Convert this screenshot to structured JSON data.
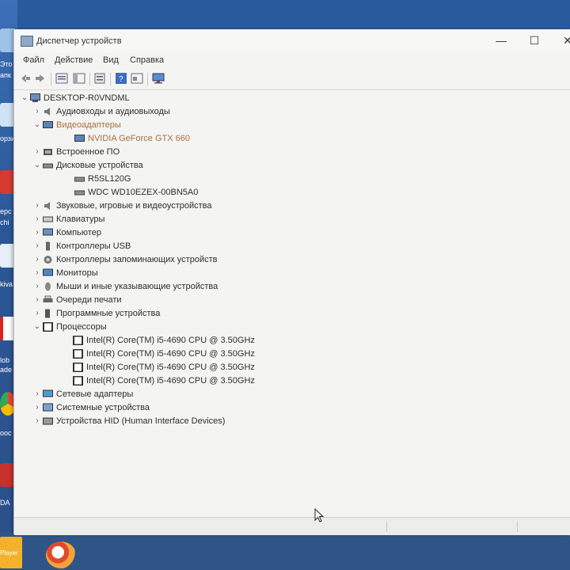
{
  "desktop": {
    "left_labels": [
      "Это",
      "апк",
      "орзи",
      "ерс",
      "chi",
      "kiva",
      "lob",
      "ade",
      "ooc",
      "DA"
    ],
    "player_label": "Player"
  },
  "window": {
    "title": "Диспетчер устройств",
    "controls": {
      "minimize": "—",
      "maximize": "☐",
      "close": "✕"
    }
  },
  "menu": [
    "Файл",
    "Действие",
    "Вид",
    "Справка"
  ],
  "tree": {
    "root": "DESKTOP-R0VNDML",
    "nodes": [
      {
        "label": "Аудиовходы и аудиовыходы",
        "expanded": false,
        "icon": "audio-icon"
      },
      {
        "label": "Видеоадаптеры",
        "expanded": true,
        "icon": "display-adapter-icon",
        "children": [
          "NVIDIA GeForce GTX 660"
        ]
      },
      {
        "label": "Встроенное ПО",
        "expanded": false,
        "icon": "firmware-icon"
      },
      {
        "label": "Дисковые устройства",
        "expanded": true,
        "icon": "disk-icon",
        "children": [
          "R5SL120G",
          "WDC WD10EZEX-00BN5A0"
        ]
      },
      {
        "label": "Звуковые, игровые и видеоустройства",
        "expanded": false,
        "icon": "sound-icon"
      },
      {
        "label": "Клавиатуры",
        "expanded": false,
        "icon": "keyboard-icon"
      },
      {
        "label": "Компьютер",
        "expanded": false,
        "icon": "computer-icon"
      },
      {
        "label": "Контроллеры USB",
        "expanded": false,
        "icon": "usb-icon"
      },
      {
        "label": "Контроллеры запоминающих устройств",
        "expanded": false,
        "icon": "storage-controller-icon"
      },
      {
        "label": "Мониторы",
        "expanded": false,
        "icon": "monitor-icon"
      },
      {
        "label": "Мыши и иные указывающие устройства",
        "expanded": false,
        "icon": "mouse-icon"
      },
      {
        "label": "Очереди печати",
        "expanded": false,
        "icon": "printer-icon"
      },
      {
        "label": "Программные устройства",
        "expanded": false,
        "icon": "software-device-icon"
      },
      {
        "label": "Процессоры",
        "expanded": true,
        "icon": "processor-icon",
        "children": [
          "Intel(R) Core(TM) i5-4690 CPU @ 3.50GHz",
          "Intel(R) Core(TM) i5-4690 CPU @ 3.50GHz",
          "Intel(R) Core(TM) i5-4690 CPU @ 3.50GHz",
          "Intel(R) Core(TM) i5-4690 CPU @ 3.50GHz"
        ]
      },
      {
        "label": "Сетевые адаптеры",
        "expanded": false,
        "icon": "network-icon"
      },
      {
        "label": "Системные устройства",
        "expanded": false,
        "icon": "system-device-icon"
      },
      {
        "label": "Устройства HID (Human Interface Devices)",
        "expanded": false,
        "icon": "hid-icon"
      }
    ]
  },
  "colors": {
    "window_bg": "#f4f4f2",
    "desktop_bg": "#2a5a9e",
    "selected_text": "#a8703a"
  }
}
